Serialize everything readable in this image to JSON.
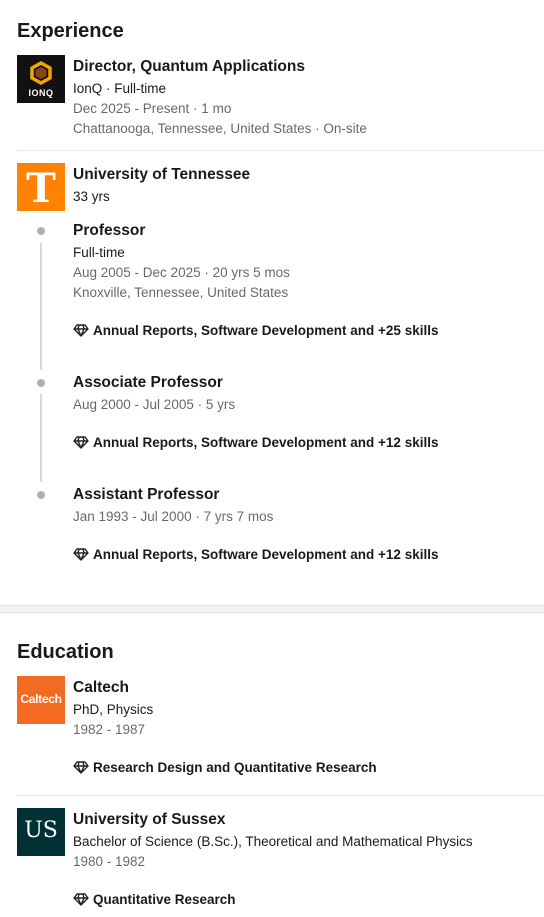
{
  "experience": {
    "title": "Experience",
    "ionq": {
      "logo_text": "IONQ",
      "role": "Director, Quantum Applications",
      "company": "IonQ · Full-time",
      "dates": "Dec 2025 - Present · 1 mo",
      "location": "Chattanooga, Tennessee, United States · On-site"
    },
    "utk": {
      "logo_letter": "T",
      "name": "University of Tennessee",
      "duration": "33 yrs",
      "roles": [
        {
          "title": "Professor",
          "type": "Full-time",
          "dates": "Aug 2005 - Dec 2025 · 20 yrs 5 mos",
          "location": "Knoxville, Tennessee, United States",
          "skills": "Annual Reports, Software Development and +25 skills"
        },
        {
          "title": "Associate Professor",
          "dates": "Aug 2000 - Jul 2005 · 5 yrs",
          "skills": "Annual Reports, Software Development and +12 skills"
        },
        {
          "title": "Assistant Professor",
          "dates": "Jan 1993 - Jul 2000 · 7 yrs 7 mos",
          "skills": "Annual Reports, Software Development and +12 skills"
        }
      ]
    }
  },
  "education": {
    "title": "Education",
    "items": [
      {
        "logo_text": "Caltech",
        "school": "Caltech",
        "degree": "PhD, Physics",
        "dates": "1982 - 1987",
        "skills": "Research Design and Quantitative Research"
      },
      {
        "logo_text": "US",
        "school": "University of Sussex",
        "degree": "Bachelor of Science (B.Sc.), Theoretical and Mathematical Physics",
        "dates": "1980 - 1982",
        "skills": "Quantitative Research"
      }
    ]
  },
  "colors": {
    "ionq_bg": "#111111",
    "ionq_accent": "#f4a300",
    "utk_orange": "#ff8200",
    "caltech_orange": "#f26b21",
    "sussex_green": "#013035"
  },
  "icons": {
    "skills": "diamond-icon"
  }
}
